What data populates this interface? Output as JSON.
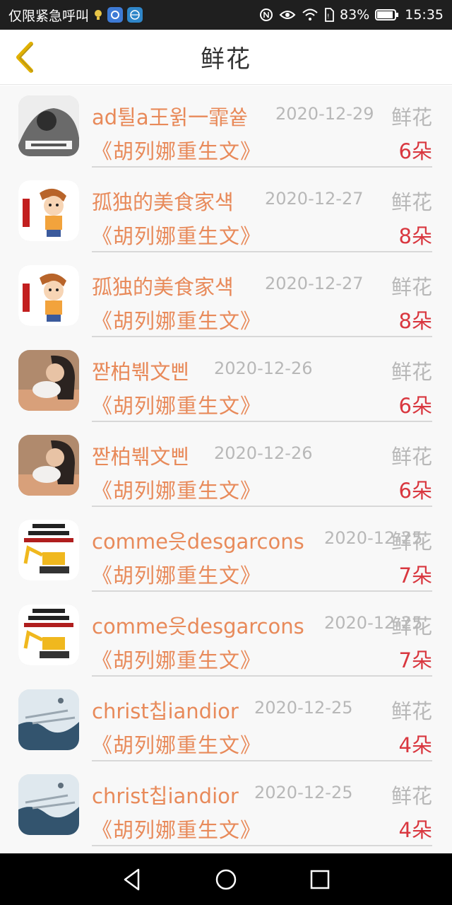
{
  "status_bar": {
    "carrier_text": "仅限紧急呼叫",
    "battery_percent": "83%",
    "time": "15:35",
    "icons": [
      "lightbulb-icon",
      "app-badge-icon",
      "globe-badge-icon",
      "nfc-icon",
      "eye-icon",
      "wifi-icon",
      "sim-icon",
      "battery-icon"
    ]
  },
  "header": {
    "title": "鲜花",
    "back_icon": "chevron-left-icon"
  },
  "colors": {
    "accent_orange": "#e88a5a",
    "count_red": "#d9373f",
    "muted_gray": "#b8b8b8",
    "back_arrow": "#e0b000"
  },
  "rows": [
    {
      "name": "ad튈a王윍一霏쓭",
      "date": "2020-12-29",
      "type": "鲜花",
      "book": "《胡列娜重生文》",
      "count": "6朵",
      "avatar": "bw-man"
    },
    {
      "name": "孤独的美食家섁",
      "date": "2020-12-27",
      "type": "鲜花",
      "book": "《胡列娜重生文》",
      "count": "8朵",
      "avatar": "cartoon-boy"
    },
    {
      "name": "孤独的美食家섁",
      "date": "2020-12-27",
      "type": "鲜花",
      "book": "《胡列娜重生文》",
      "count": "8朵",
      "avatar": "cartoon-boy"
    },
    {
      "name": "짣柏붺文삔",
      "date": "2020-12-26",
      "type": "鲜花",
      "book": "《胡列娜重生文》",
      "count": "6朵",
      "avatar": "woman-cat"
    },
    {
      "name": "짣柏붺文삔",
      "date": "2020-12-26",
      "type": "鲜花",
      "book": "《胡列娜重生文》",
      "count": "6朵",
      "avatar": "woman-cat"
    },
    {
      "name": "comme읏desgarcons",
      "date": "2020-12-25",
      "type": "鲜花",
      "book": "《胡列娜重生文》",
      "count": "7朵",
      "avatar": "excavator"
    },
    {
      "name": "comme읏desgarcons",
      "date": "2020-12-25",
      "type": "鲜花",
      "book": "《胡列娜重生文》",
      "count": "7朵",
      "avatar": "excavator"
    },
    {
      "name": "christ칩iandior",
      "date": "2020-12-25",
      "type": "鲜花",
      "book": "《胡列娜重生文》",
      "count": "4朵",
      "avatar": "blue-art"
    },
    {
      "name": "christ칩iandior",
      "date": "2020-12-25",
      "type": "鲜花",
      "book": "《胡列娜重生文》",
      "count": "4朵",
      "avatar": "blue-art"
    }
  ],
  "nav_bar": {
    "buttons": [
      "back-triangle-icon",
      "home-circle-icon",
      "recents-square-icon"
    ]
  }
}
